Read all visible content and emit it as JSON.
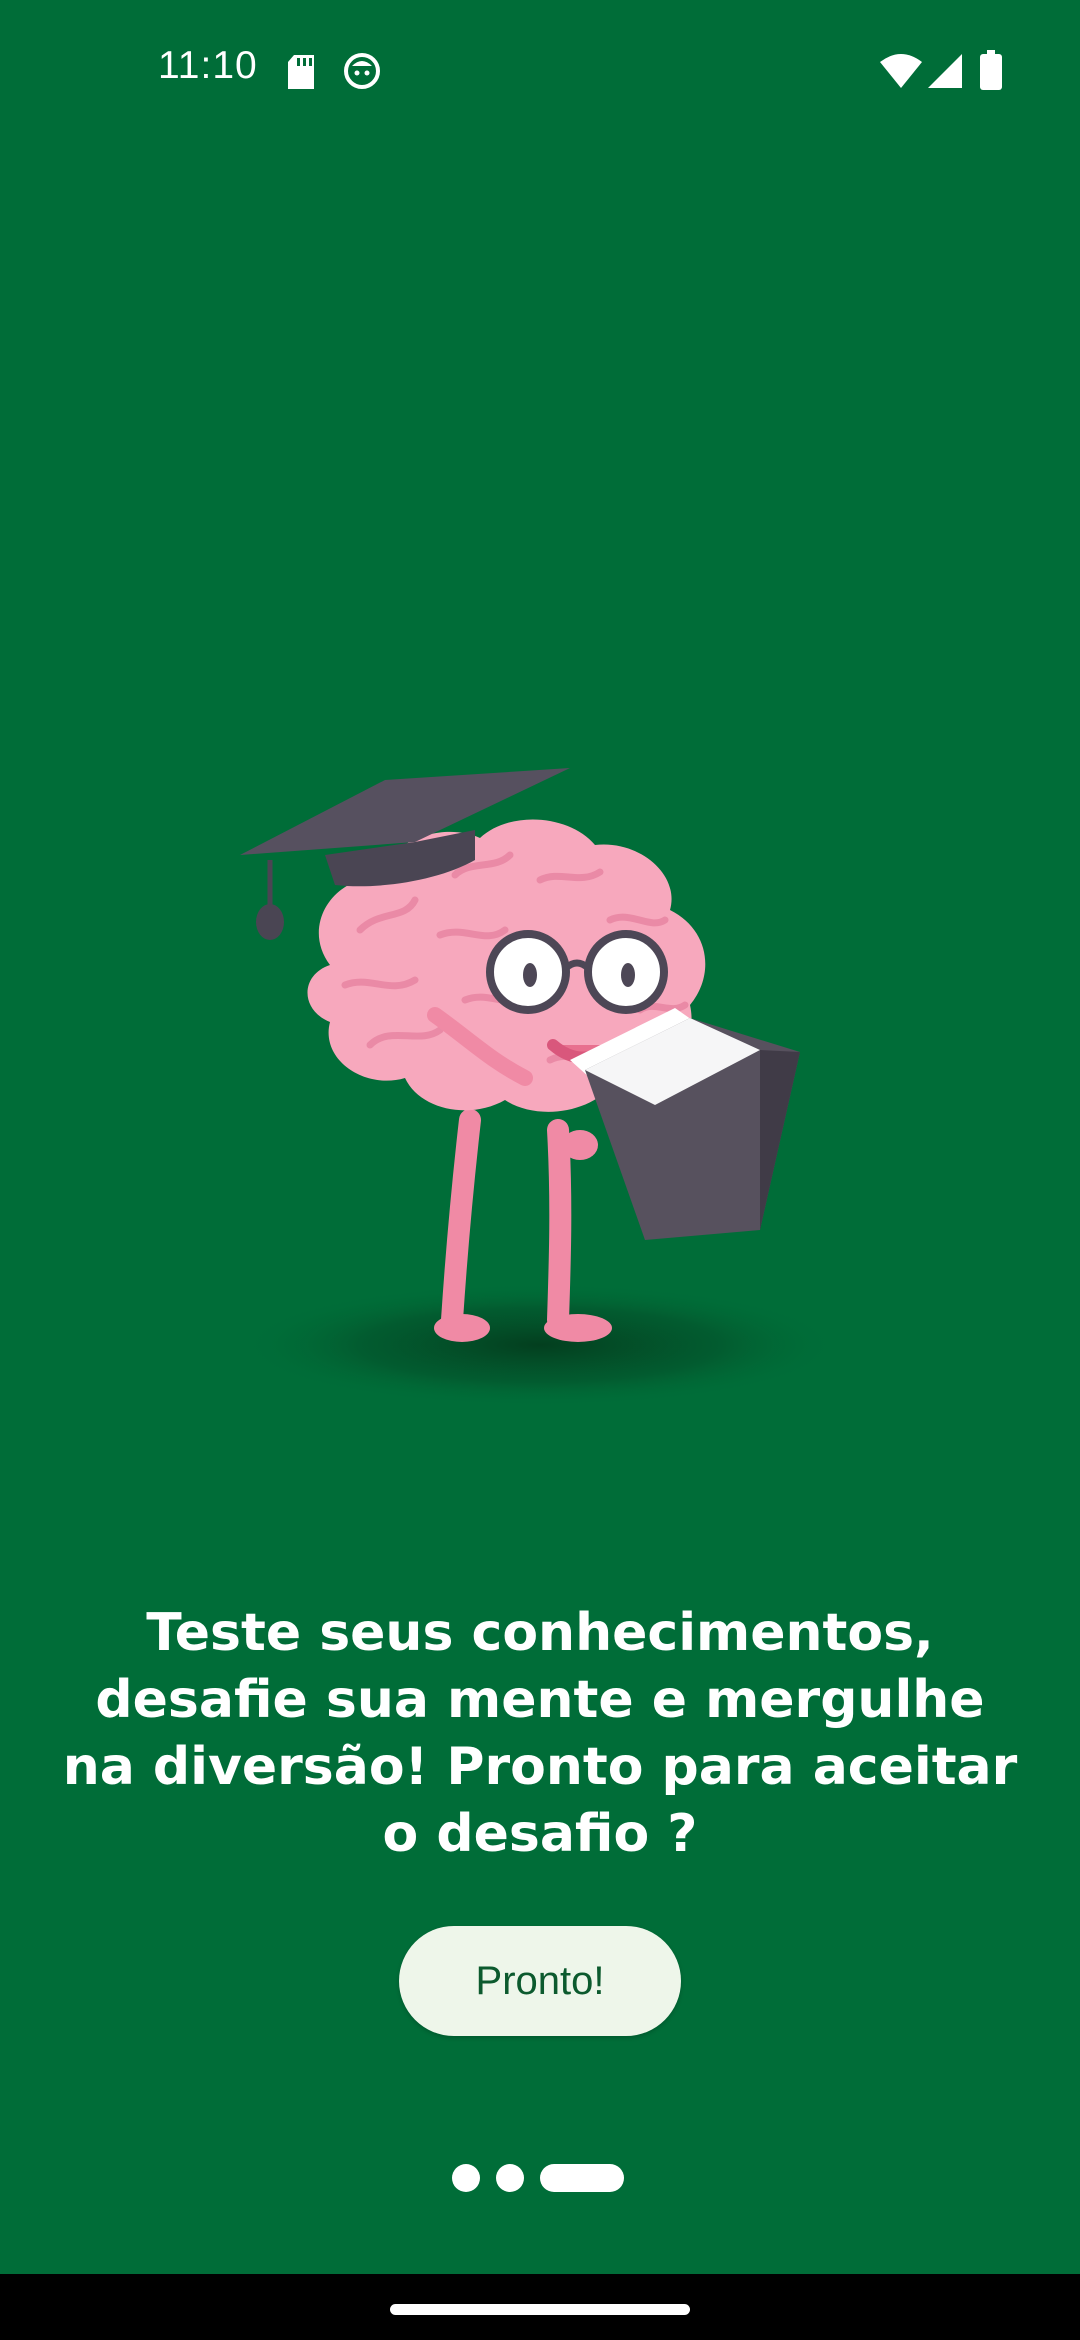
{
  "status_bar": {
    "time": "11:10",
    "icons_left": [
      "sd-card-icon",
      "face-icon"
    ],
    "icons_right": [
      "wifi-icon",
      "cellular-signal-icon",
      "battery-icon"
    ]
  },
  "illustration": {
    "icon": "graduate-brain-reading-book-icon"
  },
  "headline": "Teste seus conhecimentos, desafie sua mente e mergulhe na diversão! Pronto para aceitar o desafio ?",
  "button": {
    "label": "Pronto!"
  },
  "pager": {
    "pages": 3,
    "current": 3
  },
  "colors": {
    "background": "#006d38",
    "button_bg": "#eef6ea",
    "button_text": "#0c5a2e",
    "brain_pink": "#f4a0b8",
    "cap_gray": "#56505f"
  }
}
